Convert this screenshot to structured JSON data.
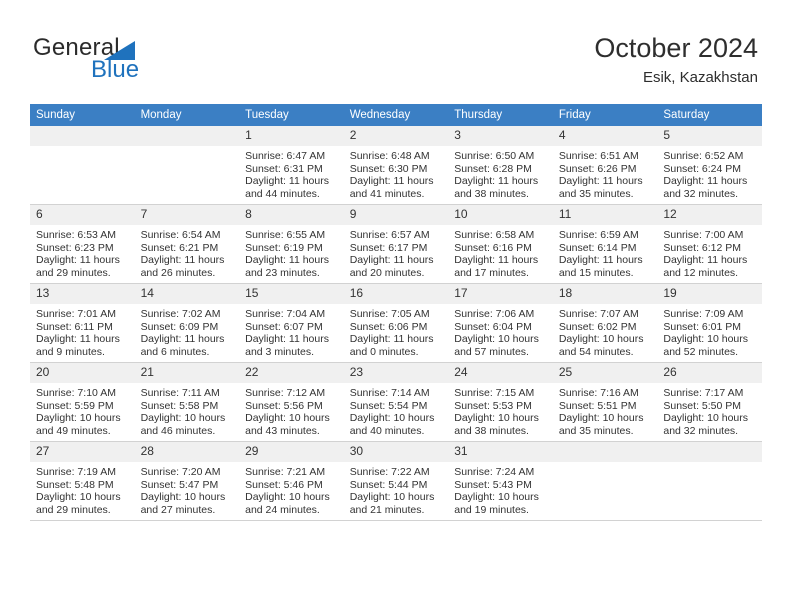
{
  "brand": {
    "name_top": "General",
    "name_bottom": "Blue",
    "triangle_color": "#1f72bd"
  },
  "header": {
    "title": "October 2024",
    "subtitle": "Esik, Kazakhstan"
  },
  "theme": {
    "header_blue": "#3b7fc4",
    "daynum_background": "#f0f0f0",
    "text": "#333333",
    "grid_line": "#d2d2d2"
  },
  "weekdays": [
    "Sunday",
    "Monday",
    "Tuesday",
    "Wednesday",
    "Thursday",
    "Friday",
    "Saturday"
  ],
  "weeks": [
    [
      {
        "day": "",
        "empty": true
      },
      {
        "day": "",
        "empty": true
      },
      {
        "day": "1",
        "sunrise": "Sunrise: 6:47 AM",
        "sunset": "Sunset: 6:31 PM",
        "daylight1": "Daylight: 11 hours",
        "daylight2": "and 44 minutes."
      },
      {
        "day": "2",
        "sunrise": "Sunrise: 6:48 AM",
        "sunset": "Sunset: 6:30 PM",
        "daylight1": "Daylight: 11 hours",
        "daylight2": "and 41 minutes."
      },
      {
        "day": "3",
        "sunrise": "Sunrise: 6:50 AM",
        "sunset": "Sunset: 6:28 PM",
        "daylight1": "Daylight: 11 hours",
        "daylight2": "and 38 minutes."
      },
      {
        "day": "4",
        "sunrise": "Sunrise: 6:51 AM",
        "sunset": "Sunset: 6:26 PM",
        "daylight1": "Daylight: 11 hours",
        "daylight2": "and 35 minutes."
      },
      {
        "day": "5",
        "sunrise": "Sunrise: 6:52 AM",
        "sunset": "Sunset: 6:24 PM",
        "daylight1": "Daylight: 11 hours",
        "daylight2": "and 32 minutes."
      }
    ],
    [
      {
        "day": "6",
        "sunrise": "Sunrise: 6:53 AM",
        "sunset": "Sunset: 6:23 PM",
        "daylight1": "Daylight: 11 hours",
        "daylight2": "and 29 minutes."
      },
      {
        "day": "7",
        "sunrise": "Sunrise: 6:54 AM",
        "sunset": "Sunset: 6:21 PM",
        "daylight1": "Daylight: 11 hours",
        "daylight2": "and 26 minutes."
      },
      {
        "day": "8",
        "sunrise": "Sunrise: 6:55 AM",
        "sunset": "Sunset: 6:19 PM",
        "daylight1": "Daylight: 11 hours",
        "daylight2": "and 23 minutes."
      },
      {
        "day": "9",
        "sunrise": "Sunrise: 6:57 AM",
        "sunset": "Sunset: 6:17 PM",
        "daylight1": "Daylight: 11 hours",
        "daylight2": "and 20 minutes."
      },
      {
        "day": "10",
        "sunrise": "Sunrise: 6:58 AM",
        "sunset": "Sunset: 6:16 PM",
        "daylight1": "Daylight: 11 hours",
        "daylight2": "and 17 minutes."
      },
      {
        "day": "11",
        "sunrise": "Sunrise: 6:59 AM",
        "sunset": "Sunset: 6:14 PM",
        "daylight1": "Daylight: 11 hours",
        "daylight2": "and 15 minutes."
      },
      {
        "day": "12",
        "sunrise": "Sunrise: 7:00 AM",
        "sunset": "Sunset: 6:12 PM",
        "daylight1": "Daylight: 11 hours",
        "daylight2": "and 12 minutes."
      }
    ],
    [
      {
        "day": "13",
        "sunrise": "Sunrise: 7:01 AM",
        "sunset": "Sunset: 6:11 PM",
        "daylight1": "Daylight: 11 hours",
        "daylight2": "and 9 minutes."
      },
      {
        "day": "14",
        "sunrise": "Sunrise: 7:02 AM",
        "sunset": "Sunset: 6:09 PM",
        "daylight1": "Daylight: 11 hours",
        "daylight2": "and 6 minutes."
      },
      {
        "day": "15",
        "sunrise": "Sunrise: 7:04 AM",
        "sunset": "Sunset: 6:07 PM",
        "daylight1": "Daylight: 11 hours",
        "daylight2": "and 3 minutes."
      },
      {
        "day": "16",
        "sunrise": "Sunrise: 7:05 AM",
        "sunset": "Sunset: 6:06 PM",
        "daylight1": "Daylight: 11 hours",
        "daylight2": "and 0 minutes."
      },
      {
        "day": "17",
        "sunrise": "Sunrise: 7:06 AM",
        "sunset": "Sunset: 6:04 PM",
        "daylight1": "Daylight: 10 hours",
        "daylight2": "and 57 minutes."
      },
      {
        "day": "18",
        "sunrise": "Sunrise: 7:07 AM",
        "sunset": "Sunset: 6:02 PM",
        "daylight1": "Daylight: 10 hours",
        "daylight2": "and 54 minutes."
      },
      {
        "day": "19",
        "sunrise": "Sunrise: 7:09 AM",
        "sunset": "Sunset: 6:01 PM",
        "daylight1": "Daylight: 10 hours",
        "daylight2": "and 52 minutes."
      }
    ],
    [
      {
        "day": "20",
        "sunrise": "Sunrise: 7:10 AM",
        "sunset": "Sunset: 5:59 PM",
        "daylight1": "Daylight: 10 hours",
        "daylight2": "and 49 minutes."
      },
      {
        "day": "21",
        "sunrise": "Sunrise: 7:11 AM",
        "sunset": "Sunset: 5:58 PM",
        "daylight1": "Daylight: 10 hours",
        "daylight2": "and 46 minutes."
      },
      {
        "day": "22",
        "sunrise": "Sunrise: 7:12 AM",
        "sunset": "Sunset: 5:56 PM",
        "daylight1": "Daylight: 10 hours",
        "daylight2": "and 43 minutes."
      },
      {
        "day": "23",
        "sunrise": "Sunrise: 7:14 AM",
        "sunset": "Sunset: 5:54 PM",
        "daylight1": "Daylight: 10 hours",
        "daylight2": "and 40 minutes."
      },
      {
        "day": "24",
        "sunrise": "Sunrise: 7:15 AM",
        "sunset": "Sunset: 5:53 PM",
        "daylight1": "Daylight: 10 hours",
        "daylight2": "and 38 minutes."
      },
      {
        "day": "25",
        "sunrise": "Sunrise: 7:16 AM",
        "sunset": "Sunset: 5:51 PM",
        "daylight1": "Daylight: 10 hours",
        "daylight2": "and 35 minutes."
      },
      {
        "day": "26",
        "sunrise": "Sunrise: 7:17 AM",
        "sunset": "Sunset: 5:50 PM",
        "daylight1": "Daylight: 10 hours",
        "daylight2": "and 32 minutes."
      }
    ],
    [
      {
        "day": "27",
        "sunrise": "Sunrise: 7:19 AM",
        "sunset": "Sunset: 5:48 PM",
        "daylight1": "Daylight: 10 hours",
        "daylight2": "and 29 minutes."
      },
      {
        "day": "28",
        "sunrise": "Sunrise: 7:20 AM",
        "sunset": "Sunset: 5:47 PM",
        "daylight1": "Daylight: 10 hours",
        "daylight2": "and 27 minutes."
      },
      {
        "day": "29",
        "sunrise": "Sunrise: 7:21 AM",
        "sunset": "Sunset: 5:46 PM",
        "daylight1": "Daylight: 10 hours",
        "daylight2": "and 24 minutes."
      },
      {
        "day": "30",
        "sunrise": "Sunrise: 7:22 AM",
        "sunset": "Sunset: 5:44 PM",
        "daylight1": "Daylight: 10 hours",
        "daylight2": "and 21 minutes."
      },
      {
        "day": "31",
        "sunrise": "Sunrise: 7:24 AM",
        "sunset": "Sunset: 5:43 PM",
        "daylight1": "Daylight: 10 hours",
        "daylight2": "and 19 minutes."
      },
      {
        "day": "",
        "empty": true
      },
      {
        "day": "",
        "empty": true
      }
    ]
  ]
}
